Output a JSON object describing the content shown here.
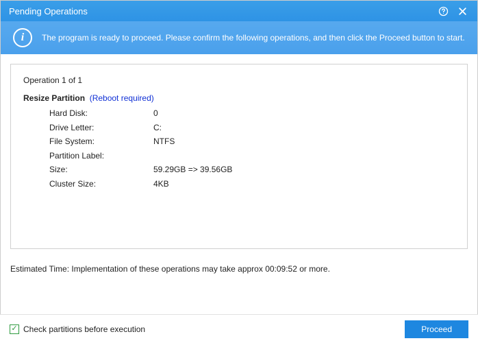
{
  "window": {
    "title": "Pending Operations"
  },
  "infobar": {
    "message": "The program is ready to proceed. Please confirm the following operations, and then click the Proceed button to start."
  },
  "operation": {
    "counter": "Operation 1 of 1",
    "name": "Resize Partition",
    "note": "(Reboot required)",
    "rows": {
      "hard_disk": {
        "label": "Hard Disk:",
        "value": "0"
      },
      "drive_letter": {
        "label": "Drive Letter:",
        "value": "C:"
      },
      "file_system": {
        "label": "File System:",
        "value": "NTFS"
      },
      "partition_label": {
        "label": "Partition Label:",
        "value": ""
      },
      "size": {
        "label": "Size:",
        "value": "59.29GB => 39.56GB"
      },
      "cluster_size": {
        "label": "Cluster Size:",
        "value": "4KB"
      }
    }
  },
  "estimate": "Estimated Time: Implementation of these operations may take approx 00:09:52 or more.",
  "footer": {
    "checkbox_label": "Check partitions before execution",
    "checkbox_checked": true,
    "proceed_label": "Proceed"
  }
}
